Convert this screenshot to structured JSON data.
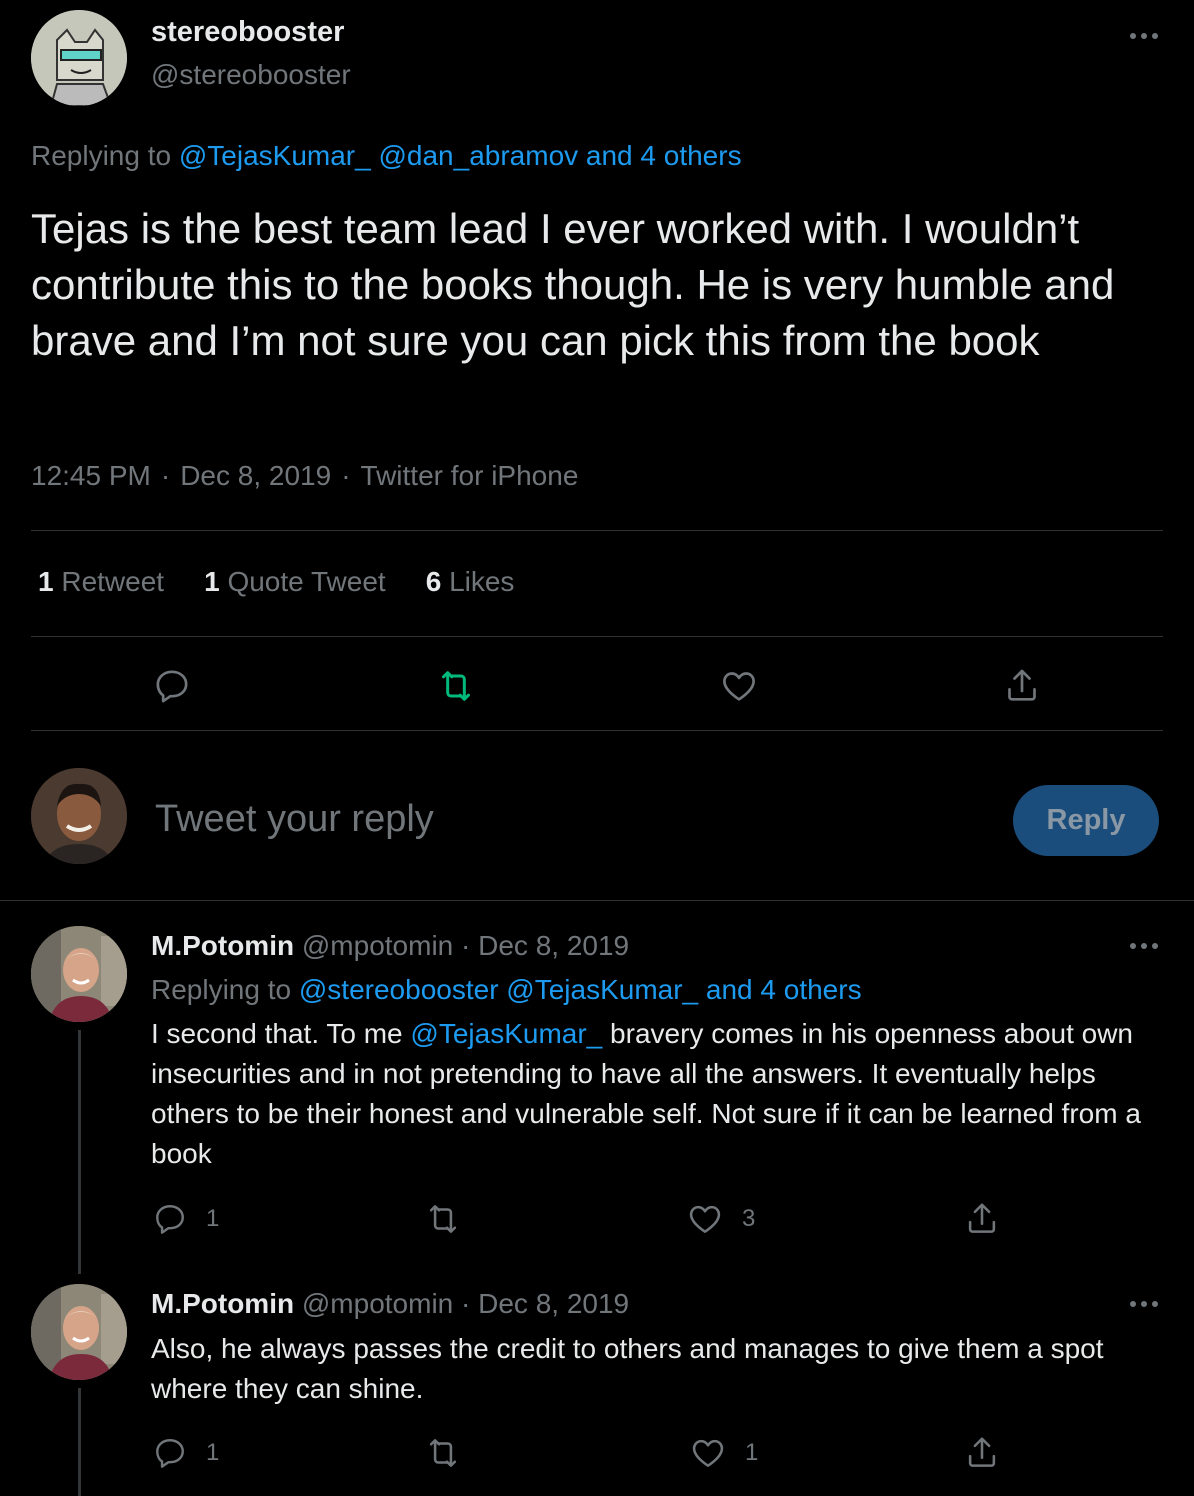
{
  "main_tweet": {
    "name": "stereobooster",
    "handle": "@stereobooster",
    "replying_prefix": "Replying to",
    "replying_mentions": "@TejasKumar_ @dan_abramov and 4 others",
    "text": "Tejas is the best team lead I ever worked with. I wouldn’t contribute this to the books though. He is very humble and brave and I’m not sure you can pick this from the book",
    "time": "12:45 PM",
    "date": "Dec 8, 2019",
    "source": "Twitter for iPhone",
    "stats": {
      "retweets_count": "1",
      "retweets_label": "Retweet",
      "quotes_count": "1",
      "quotes_label": "Quote Tweet",
      "likes_count": "6",
      "likes_label": "Likes"
    }
  },
  "composer": {
    "placeholder": "Tweet your reply",
    "button_label": "Reply"
  },
  "replies": [
    {
      "name": "M.Potomin",
      "handle": "@mpotomin",
      "date": "Dec 8, 2019",
      "replying_prefix": "Replying to",
      "replying_mentions": "@stereobooster @TejasKumar_ and 4 others",
      "text_before": "I second that. To me ",
      "text_mention": "@TejasKumar_",
      "text_after": " bravery comes in his openness about own insecurities and in not pretending to have all the answers. It eventually helps others to be their honest and vulnerable self. Not sure if it can be learned from a book",
      "reply_count": "1",
      "like_count": "3"
    },
    {
      "name": "M.Potomin",
      "handle": "@mpotomin",
      "date": "Dec 8, 2019",
      "text": "Also, he always passes the credit to others and manages to give them a spot where they can shine.",
      "reply_count": "1",
      "like_count": "1"
    }
  ],
  "colors": {
    "background": "#000000",
    "text": "#e7e9ea",
    "muted": "#71767b",
    "link": "#1d9bf0",
    "retweet_active": "#00ba7c",
    "reply_button": "#1a4d7c",
    "divider": "#2f3336"
  },
  "separator_dot": "·"
}
